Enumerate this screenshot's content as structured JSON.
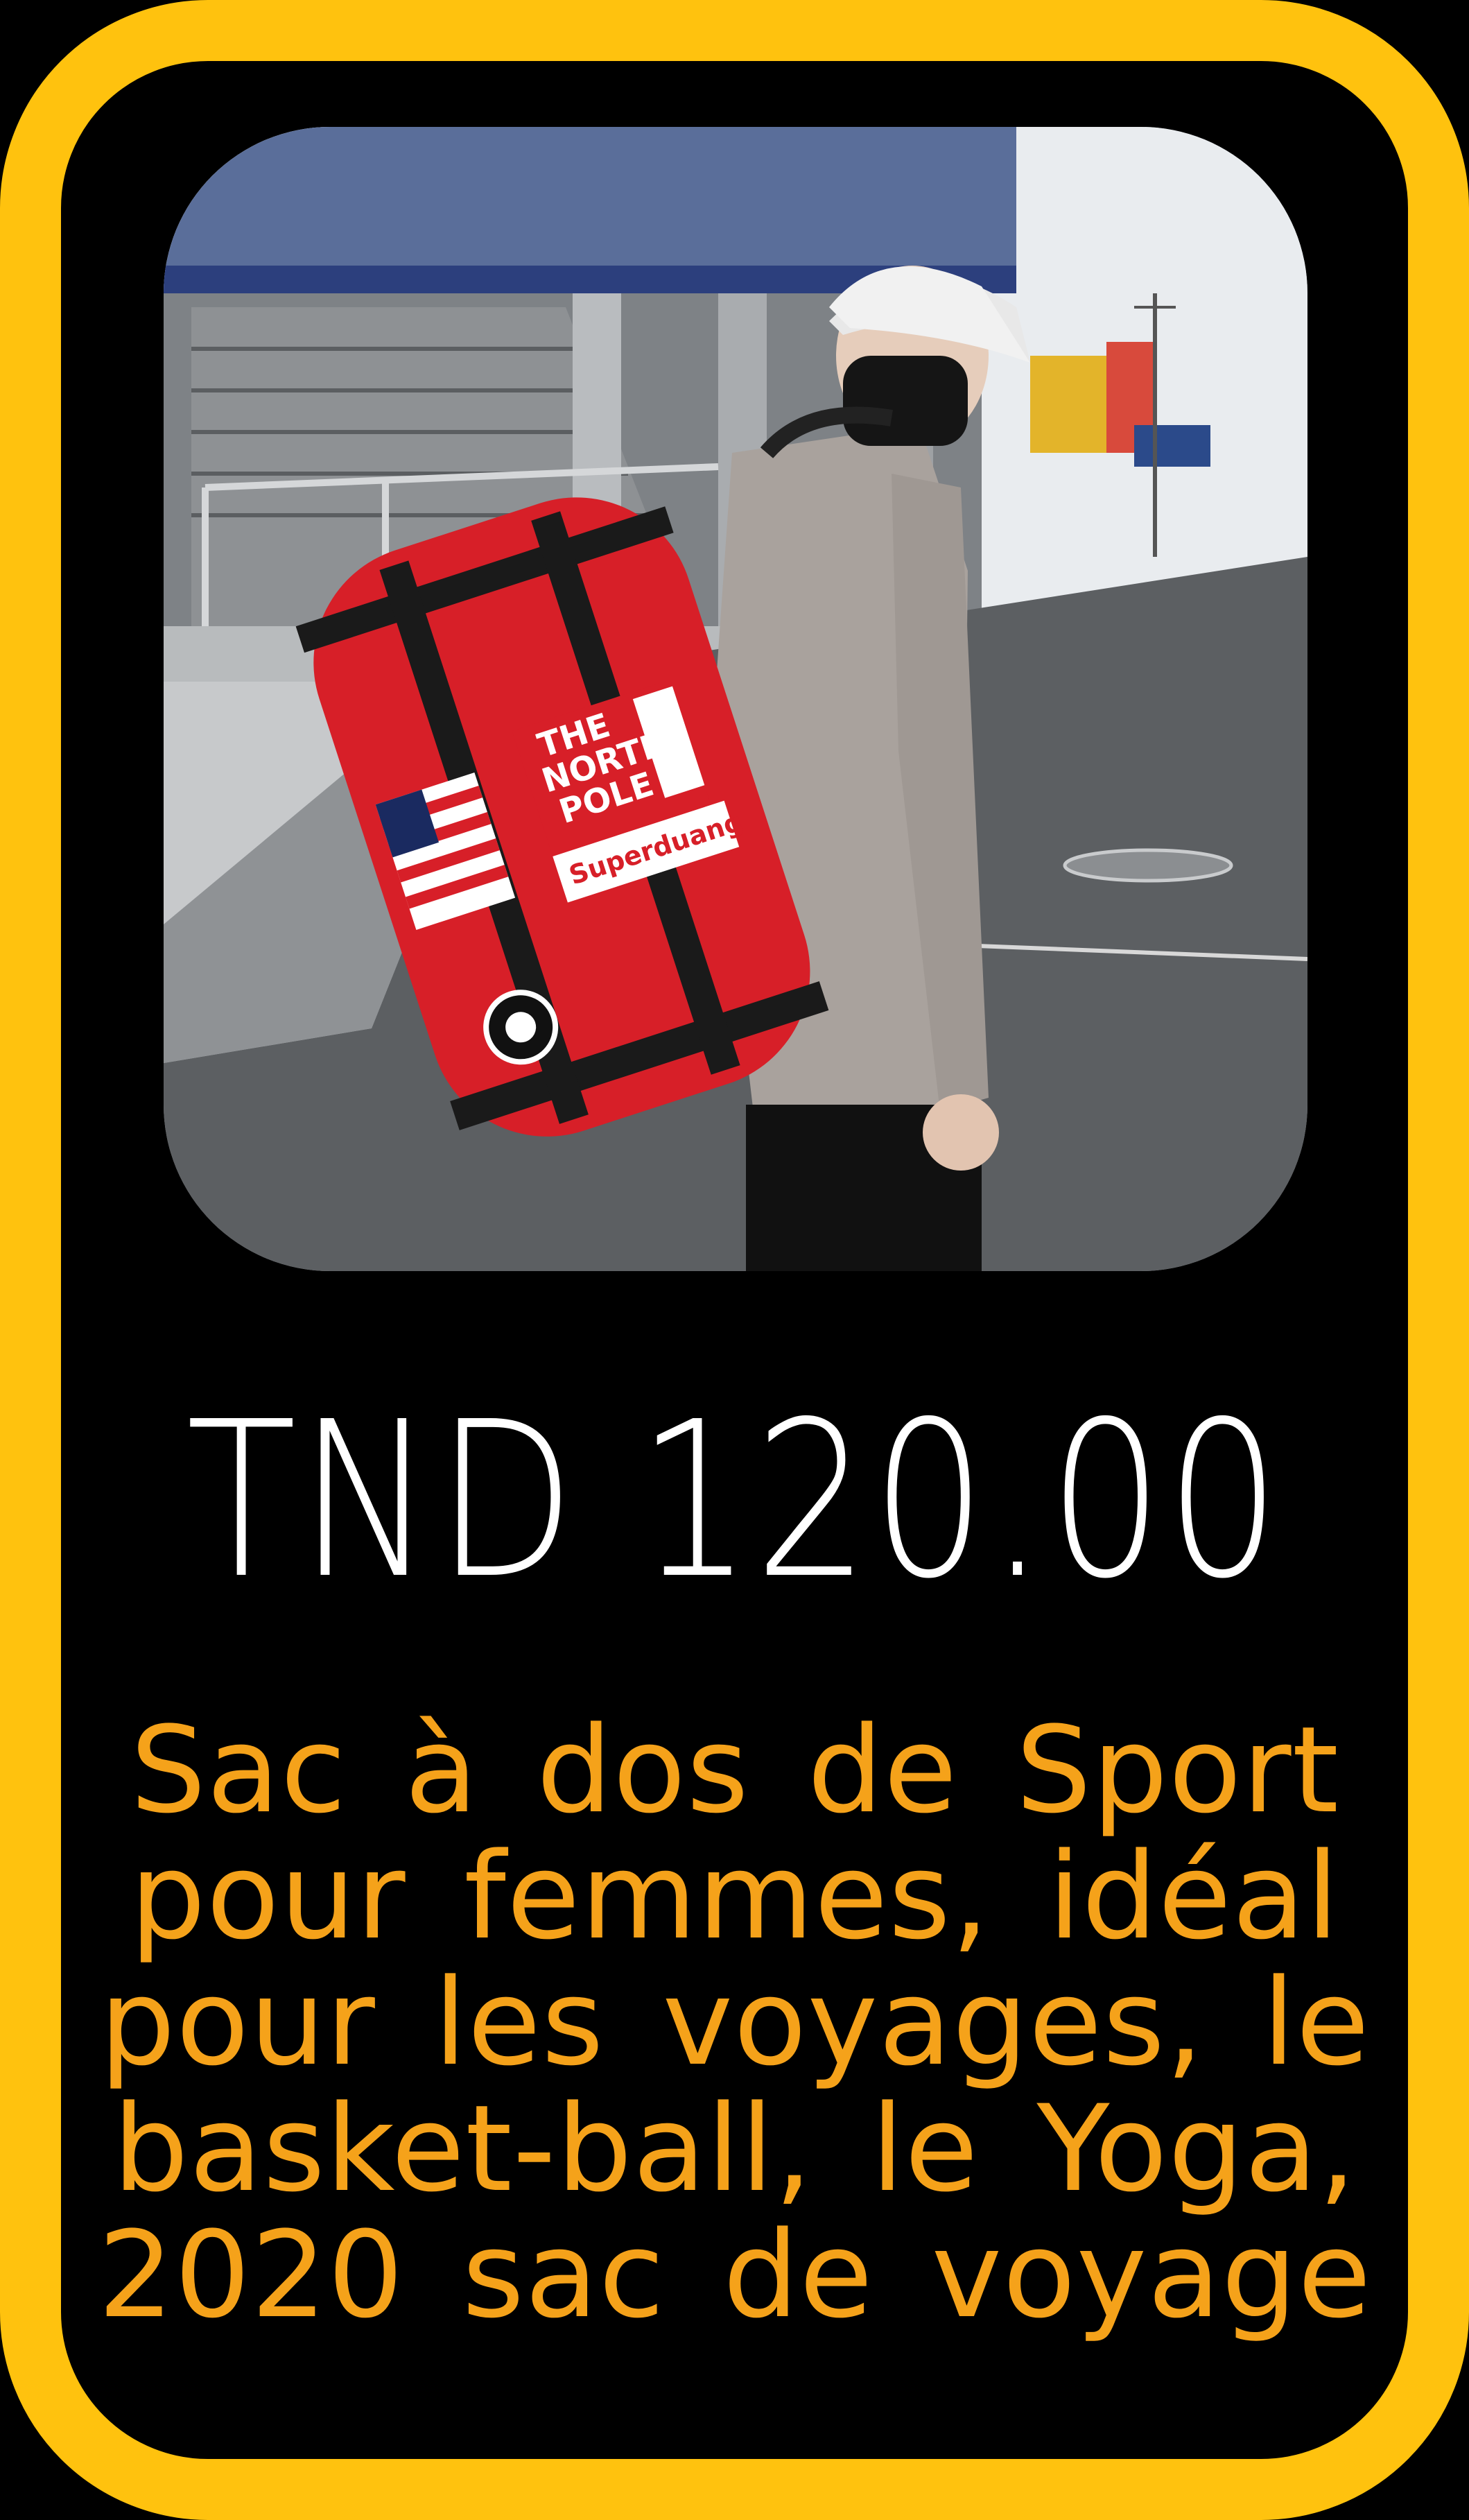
{
  "product": {
    "price": "TND 120.00",
    "description_lines": [
      "Sac à dos de Sport",
      "pour femmes, idéal",
      "pour les voyages, le",
      "basket-ball, le Yoga,",
      "2020 sac de voyage"
    ],
    "image_icon": "product-photo-icon",
    "bag_brand_text": [
      "THE",
      "NORTH",
      "POLE"
    ],
    "bag_patch_text": "Superduang"
  },
  "colors": {
    "frame": "#FFC20E",
    "background": "#000000",
    "price": "#FFFFFF",
    "description": "#F5A21A",
    "bag": "#D71F28"
  }
}
